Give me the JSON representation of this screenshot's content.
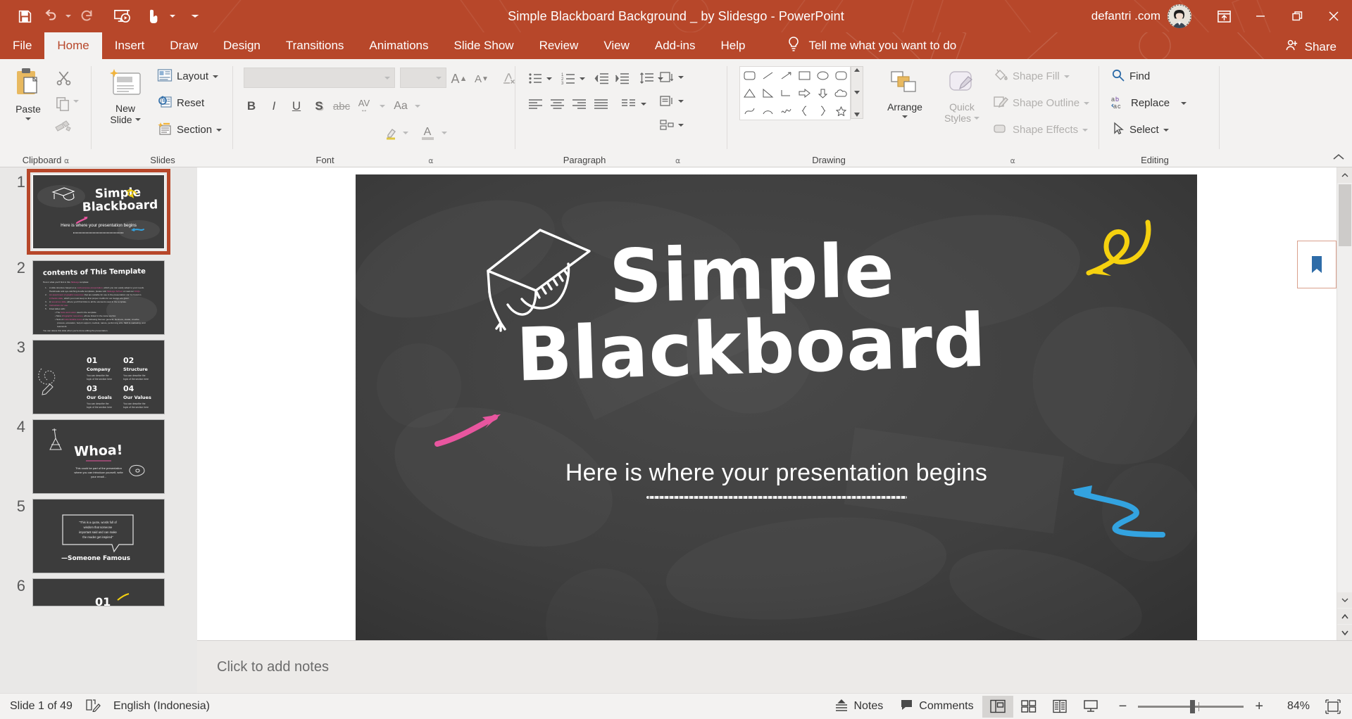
{
  "window": {
    "title": "Simple Blackboard Background _ by Slidesgo  -  PowerPoint",
    "account_name": "defantri .com",
    "minimize_label": "Minimize",
    "restore_label": "Restore Down",
    "close_label": "Close",
    "ribbon_display_label": "Ribbon Display Options"
  },
  "quick_access": [
    {
      "name": "save-icon",
      "label": "Save"
    },
    {
      "name": "undo-icon",
      "label": "Undo"
    },
    {
      "name": "redo-icon",
      "label": "Repeat"
    },
    {
      "name": "start-from-beginning-icon",
      "label": "Start From Beginning"
    },
    {
      "name": "touch-mode-icon",
      "label": "Touch/Mouse Mode"
    },
    {
      "name": "customize-qat-icon",
      "label": "Customize Quick Access Toolbar"
    }
  ],
  "tabs": [
    {
      "label": "File",
      "active": false
    },
    {
      "label": "Home",
      "active": true
    },
    {
      "label": "Insert",
      "active": false
    },
    {
      "label": "Draw",
      "active": false
    },
    {
      "label": "Design",
      "active": false
    },
    {
      "label": "Transitions",
      "active": false
    },
    {
      "label": "Animations",
      "active": false
    },
    {
      "label": "Slide Show",
      "active": false
    },
    {
      "label": "Review",
      "active": false
    },
    {
      "label": "View",
      "active": false
    },
    {
      "label": "Add-ins",
      "active": false
    },
    {
      "label": "Help",
      "active": false
    }
  ],
  "tell_me": "Tell me what you want to do",
  "share": "Share",
  "ribbon": {
    "groups": [
      {
        "label": "Clipboard",
        "has_launcher": true
      },
      {
        "label": "Slides",
        "has_launcher": false
      },
      {
        "label": "Font",
        "has_launcher": true
      },
      {
        "label": "Paragraph",
        "has_launcher": true
      },
      {
        "label": "Drawing",
        "has_launcher": true
      },
      {
        "label": "Editing",
        "has_launcher": false
      }
    ],
    "clipboard": {
      "paste": "Paste",
      "cut": "Cut",
      "copy": "Copy",
      "format_painter": "Format Painter"
    },
    "slides": {
      "new_slide": "New\nSlide",
      "new_slide_line1": "New",
      "new_slide_line2": "Slide",
      "layout": "Layout",
      "reset": "Reset",
      "section": "Section"
    },
    "font": {
      "font_name": "",
      "font_size": "",
      "grow": "Increase Font Size",
      "shrink": "Decrease Font Size",
      "clear_format": "Clear All Formatting",
      "bold": "B",
      "italic": "I",
      "underline": "U",
      "shadow": "S",
      "strikethrough": "abc",
      "spacing": "AV",
      "change_case": "Aa",
      "highlight": "Text Highlight Color",
      "font_color": "A"
    },
    "drawing": {
      "arrange": "Arrange",
      "quick_styles_line1": "Quick",
      "quick_styles_line2": "Styles",
      "shape_fill": "Shape Fill",
      "shape_outline": "Shape Outline",
      "shape_effects": "Shape Effects"
    },
    "editing": {
      "find": "Find",
      "replace": "Replace",
      "select": "Select"
    },
    "collapse_label": "Collapse the Ribbon"
  },
  "slides_panel": {
    "thumbnails": [
      {
        "number": "1",
        "selected": true,
        "kind": "title",
        "title_l1": "Simple",
        "title_l2": "Blackboard",
        "sub": "Here is where your presentation begins"
      },
      {
        "number": "2",
        "selected": false,
        "kind": "contents",
        "title": "contents of This Template"
      },
      {
        "number": "3",
        "selected": false,
        "kind": "sections",
        "items": [
          {
            "num": "01",
            "name": "Company",
            "desc": "You can describe the topic of the section here"
          },
          {
            "num": "02",
            "name": "Structure",
            "desc": "You can describe the topic of the section here"
          },
          {
            "num": "03",
            "name": "Our Goals",
            "desc": "You can describe the topic of the section here"
          },
          {
            "num": "04",
            "name": "Our Values",
            "desc": "You can describe the topic of the section here"
          }
        ]
      },
      {
        "number": "4",
        "selected": false,
        "kind": "whoa",
        "title": "Whoa!",
        "sub": "This could be part of the presentation where you can introduce yourself, write your email..."
      },
      {
        "number": "5",
        "selected": false,
        "kind": "quote",
        "quote": "\"This is a quote, words full of wisdom that someone important said and can make the reader get inspired\"",
        "attribution": "—Someone Famous"
      },
      {
        "number": "6",
        "selected": false,
        "kind": "numbered",
        "num": "01"
      }
    ]
  },
  "slide": {
    "title_line1": "Simple",
    "title_line2": "Blackboard",
    "subtitle": "Here is where your presentation begins",
    "decorations": [
      {
        "name": "graduation-cap-doodle",
        "color": "#ffffff"
      },
      {
        "name": "yellow-curly-arrow-doodle",
        "color": "#f5d10f"
      },
      {
        "name": "pink-arrow-doodle",
        "color": "#e8569f"
      },
      {
        "name": "blue-squiggle-arrow-doodle",
        "color": "#33a3e0"
      }
    ],
    "background_color": "#3e3e3e"
  },
  "notes": {
    "placeholder": "Click to add notes"
  },
  "status_bar": {
    "slide_indicator": "Slide 1 of 49",
    "language": "English (Indonesia)",
    "spellcheck_label": "Spelling and Grammar Check",
    "notes": "Notes",
    "comments": "Comments",
    "views": [
      {
        "name": "normal-view",
        "label": "Normal",
        "active": true
      },
      {
        "name": "slide-sorter-view",
        "label": "Slide Sorter",
        "active": false
      },
      {
        "name": "reading-view",
        "label": "Reading View",
        "active": false
      },
      {
        "name": "slide-show-view",
        "label": "Slide Show",
        "active": false
      }
    ],
    "zoom_out": "−",
    "zoom_in": "+",
    "zoom_level": "84%",
    "fit_label": "Fit slide to current window"
  },
  "colors": {
    "accent": "#b7472a",
    "ribbon_bg": "#f3f2f1",
    "board": "#3e3e3e",
    "chalk": "#ffffff",
    "pink": "#e8569f",
    "yellow": "#f5d10f",
    "blue": "#33a3e0"
  }
}
